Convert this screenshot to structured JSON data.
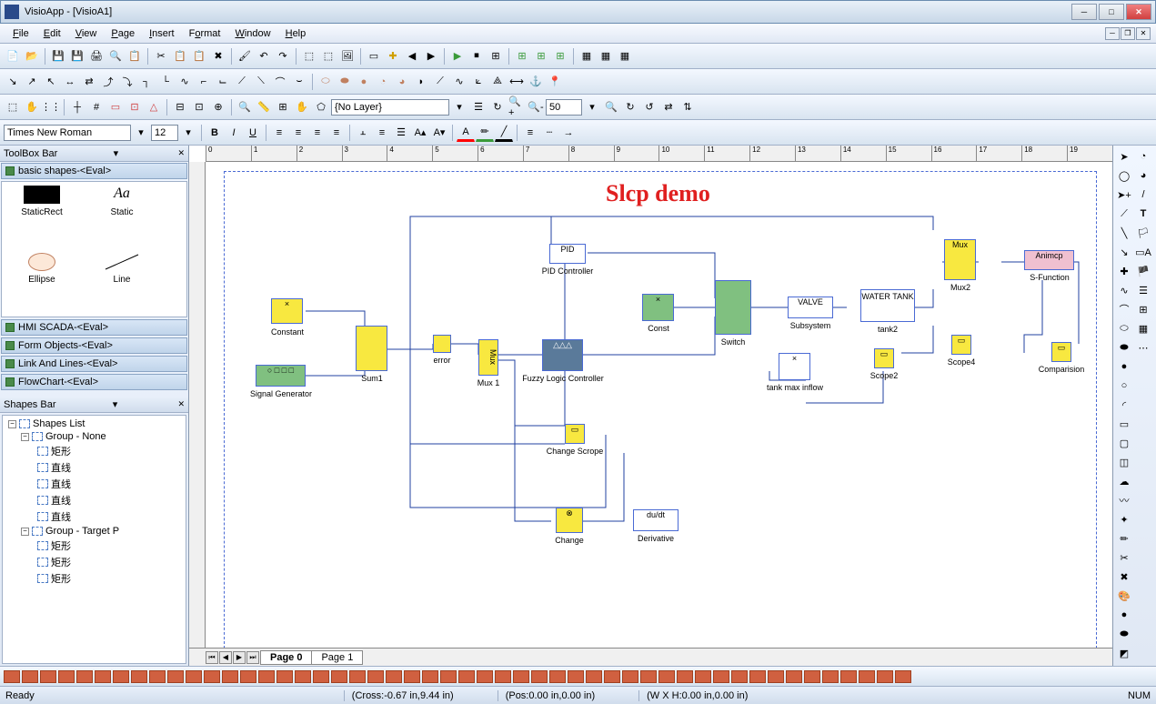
{
  "app": {
    "title": "VisioApp - [VisioA1]"
  },
  "menu": [
    "File",
    "Edit",
    "View",
    "Page",
    "Insert",
    "Format",
    "Window",
    "Help"
  ],
  "font": {
    "name": "Times New Roman",
    "size": "12"
  },
  "layer": {
    "current": "{No Layer}"
  },
  "zoom": {
    "value": "50"
  },
  "toolbox": {
    "title": "ToolBox Bar",
    "sections": [
      "basic shapes-<Eval>",
      "HMI SCADA-<Eval>",
      "Form Objects-<Eval>",
      "Link And Lines-<Eval>",
      "FlowChart-<Eval>"
    ],
    "shapes": [
      {
        "label": "StaticRect"
      },
      {
        "label": "Static",
        "italic": "Aa"
      },
      {
        "label": "Ellipse"
      },
      {
        "label": "Line"
      }
    ]
  },
  "shapesbar": {
    "title": "Shapes Bar",
    "root": "Shapes List",
    "groups": [
      {
        "name": "Group - None",
        "children": [
          "矩形",
          "直线",
          "直线",
          "直线",
          "直线"
        ]
      },
      {
        "name": "Group - Target P",
        "children": [
          "矩形",
          "矩形",
          "矩形"
        ]
      }
    ]
  },
  "doc": {
    "title": "Slcp demo"
  },
  "blocks": {
    "constant": "Constant",
    "sum1": "Sum1",
    "error": "error",
    "mux1": "Mux 1",
    "fuzzy": "Fuzzy Logic Controller",
    "pid": "PID",
    "pidctrl": "PID Controller",
    "const": "Const",
    "switch": "Switch",
    "valve": "VALVE",
    "subsystem": "Subsystem",
    "watertank": "WATER TANK",
    "tank2": "tank2",
    "tankmax": "tank max inflow",
    "mux2": "Mux2",
    "mux2box": "Mux",
    "scope2": "Scope2",
    "scope4": "Scope4",
    "animcp": "Animcp",
    "sfunction": "S-Function",
    "comparison": "Comparision",
    "siggen": "Signal Generator",
    "changescope": "Change Scrope",
    "change": "Change",
    "derivative": "Derivative",
    "dudt": "du/dt",
    "x": "×"
  },
  "pagetabs": {
    "page0": "Page   0",
    "page1": "Page  1"
  },
  "status": {
    "ready": "Ready",
    "cross": "(Cross:-0.67 in,9.44 in)",
    "pos": "(Pos:0.00 in,0.00 in)",
    "wh": "(W X H:0.00 in,0.00 in)",
    "num": "NUM"
  },
  "ruler_ticks": [
    "0",
    "1",
    "2",
    "3",
    "4",
    "5",
    "6",
    "7",
    "8",
    "9",
    "10",
    "11",
    "12",
    "13",
    "14",
    "15",
    "16",
    "17",
    "18",
    "19"
  ]
}
